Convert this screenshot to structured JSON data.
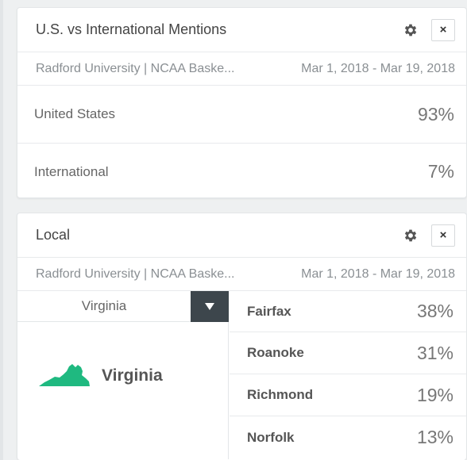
{
  "us_vs_international": {
    "title": "U.S. vs International Mentions",
    "source": "Radford University | NCAA Baske...",
    "date_range": "Mar 1, 2018 - Mar 19, 2018",
    "close_label": "×",
    "rows": [
      {
        "label": "United States",
        "value": "93%"
      },
      {
        "label": "International",
        "value": "7%"
      }
    ]
  },
  "local": {
    "title": "Local",
    "source": "Radford University | NCAA Baske...",
    "date_range": "Mar 1, 2018 - Mar 19, 2018",
    "close_label": "×",
    "region_select": {
      "selected": "Virginia"
    },
    "region_display": {
      "name": "Virginia"
    },
    "cities": [
      {
        "name": "Fairfax",
        "value": "38%"
      },
      {
        "name": "Roanoke",
        "value": "31%"
      },
      {
        "name": "Richmond",
        "value": "19%"
      },
      {
        "name": "Norfolk",
        "value": "13%"
      }
    ]
  },
  "icons": {
    "settings": "gear-icon",
    "close": "close-icon",
    "dropdown": "caret-down-icon",
    "state_map": "virginia-map-icon"
  },
  "colors": {
    "state_map": "#1fb980",
    "dropdown_toggle": "#3d464c"
  }
}
